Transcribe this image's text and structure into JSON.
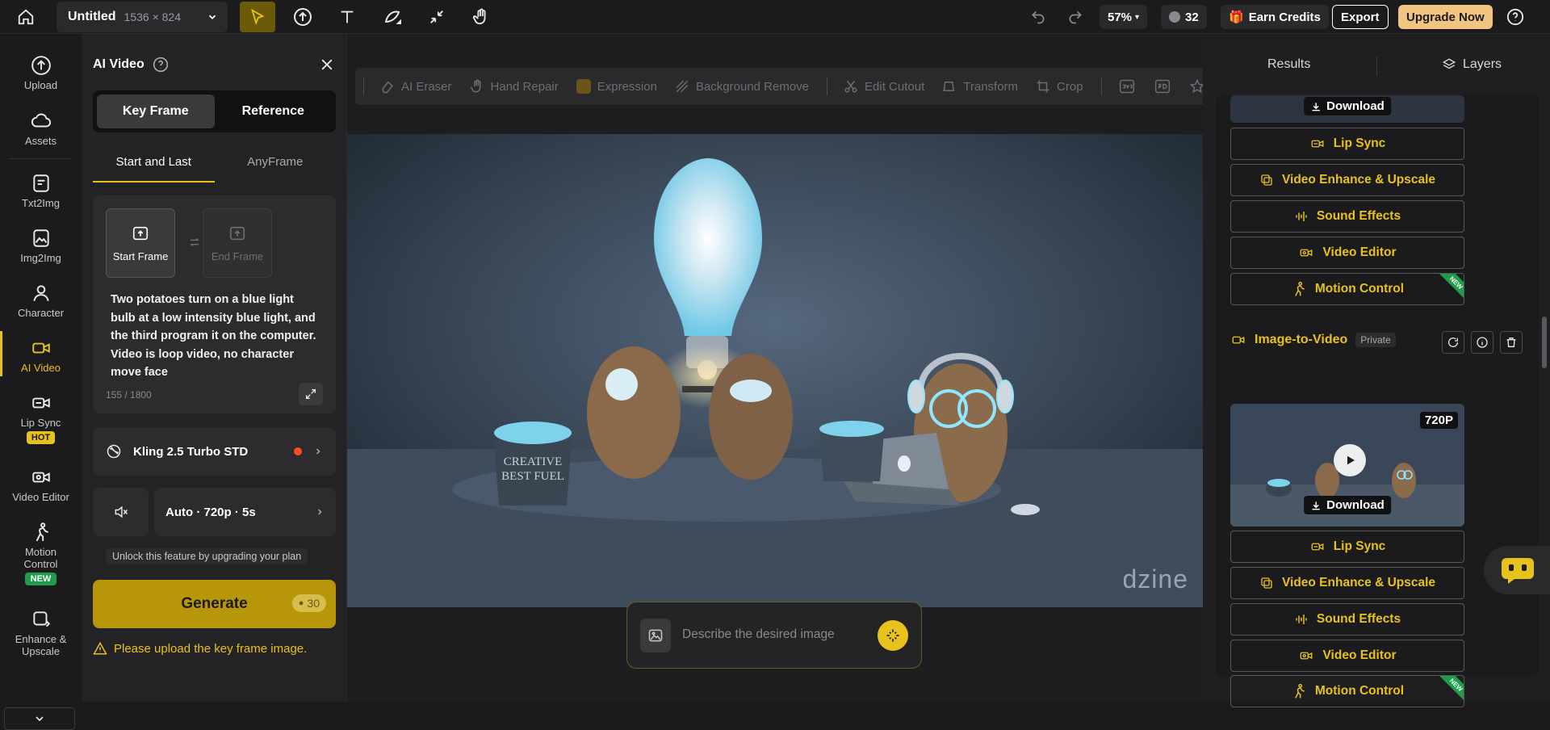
{
  "topbar": {
    "doc_name": "Untitled",
    "doc_dims": "1536 × 824",
    "zoom": "57%",
    "credits": "32",
    "earn_credits": "Earn Credits",
    "export": "Export",
    "upgrade": "Upgrade Now"
  },
  "nav": {
    "upload": "Upload",
    "assets": "Assets",
    "txt2img": "Txt2Img",
    "img2img": "Img2Img",
    "character": "Character",
    "ai_video": "AI Video",
    "lip_sync": "Lip Sync",
    "hot": "HOT",
    "video_editor": "Video Editor",
    "motion_control": "Motion\nControl",
    "new": "NEW",
    "enhance": "Enhance &\nUpscale"
  },
  "panel": {
    "title": "AI Video",
    "seg_keyframe": "Key Frame",
    "seg_reference": "Reference",
    "tab_start_last": "Start and Last",
    "tab_anyframe": "AnyFrame",
    "start_frame": "Start Frame",
    "end_frame": "End Frame",
    "prompt": "Two potatoes turn on a blue light bulb at a low intensity blue light, and the third program it on the computer. Video is loop video, no character move face",
    "char_count": "155 / 1800",
    "model": "Kling 2.5 Turbo STD",
    "settings": "Auto · 720p · 5s",
    "unlock": "Unlock this feature by upgrading your plan",
    "generate": "Generate",
    "generate_cost": "30",
    "warning": "Please upload the key frame image."
  },
  "toolstrip": {
    "items": [
      "AI Eraser",
      "Hand Repair",
      "Expression",
      "Background Remove",
      "Edit Cutout",
      "Transform",
      "Crop"
    ]
  },
  "canvas": {
    "watermark": "dzine",
    "describe_placeholder": "Describe the desired image",
    "jar_text_1": "CREATIVE",
    "jar_text_2": "BEST FUEL"
  },
  "results": {
    "tab_results": "Results",
    "tab_layers": "Layers",
    "download": "Download",
    "actions": [
      "Lip Sync",
      "Video Enhance & Upscale",
      "Sound Effects",
      "Video Editor",
      "Motion Control"
    ],
    "card2_title": "Image-to-Video",
    "card2_private": "Private",
    "card2_res": "720P",
    "new_ribbon": "NEW"
  },
  "colors": {
    "accent": "#e8c21c",
    "generate_bg": "#b8960a",
    "upgrade_bg": "#f2c482",
    "new_green": "#1e9e4a",
    "record_dot": "#ff4b1f"
  }
}
